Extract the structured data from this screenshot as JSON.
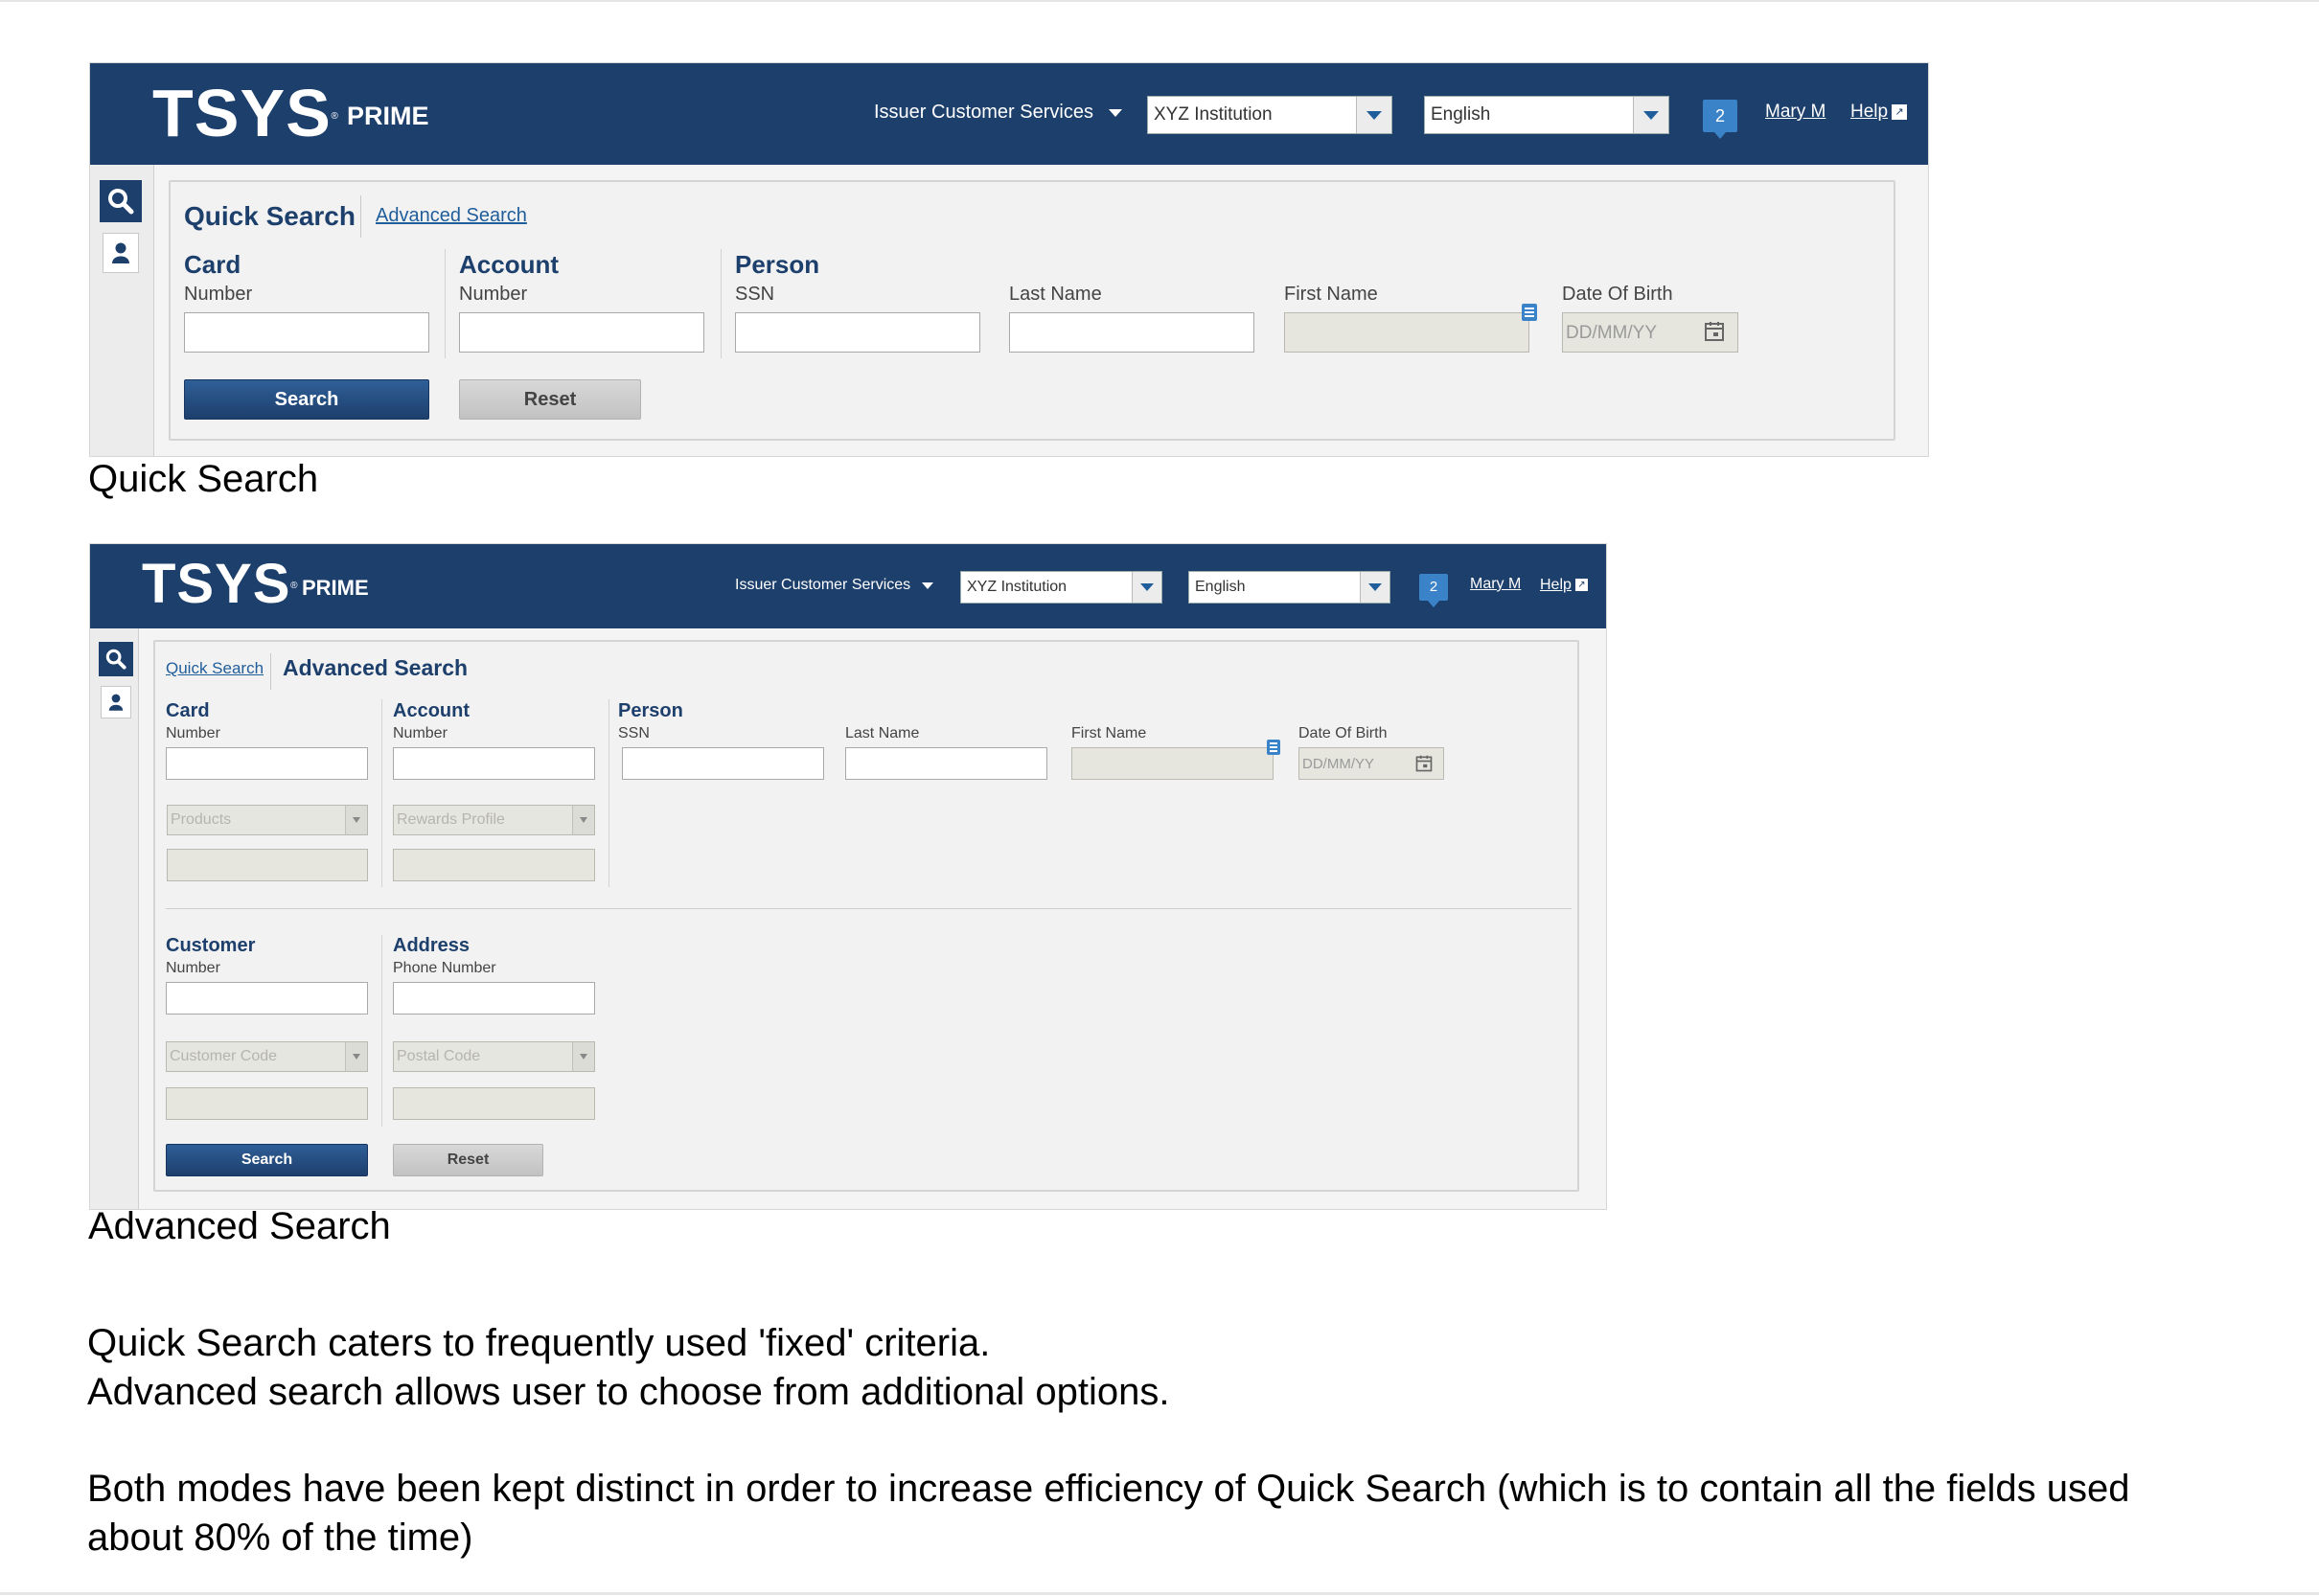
{
  "header": {
    "logo_text": "TSYS",
    "logo_mark": "®",
    "product": "PRIME",
    "service_menu": "Issuer Customer Services",
    "institution": "XYZ Institution",
    "language": "English",
    "notification_count": "2",
    "user": "Mary M",
    "help": "Help",
    "colors": {
      "header_bg": "#1d3f6c",
      "accent": "#3b83c9"
    }
  },
  "quick": {
    "title": "Quick Search",
    "other_link": "Advanced Search",
    "groups": {
      "card": {
        "title": "Card",
        "label": "Number"
      },
      "account": {
        "title": "Account",
        "label": "Number"
      },
      "person": {
        "title": "Person",
        "ssn": "SSN",
        "last_name": "Last Name",
        "first_name": "First Name",
        "dob": "Date Of Birth",
        "dob_placeholder": "DD/MM/YY"
      }
    },
    "search_button": "Search",
    "reset_button": "Reset",
    "caption": "Quick Search"
  },
  "advanced": {
    "title": "Advanced Search",
    "other_link": "Quick Search",
    "groups": {
      "card": {
        "title": "Card",
        "label": "Number",
        "dropdown": "Products"
      },
      "account": {
        "title": "Account",
        "label": "Number",
        "dropdown": "Rewards Profile"
      },
      "person": {
        "title": "Person",
        "ssn": "SSN",
        "last_name": "Last Name",
        "first_name": "First Name",
        "dob": "Date Of Birth",
        "dob_placeholder": "DD/MM/YY"
      },
      "customer": {
        "title": "Customer",
        "label": "Number",
        "dropdown": "Customer Code"
      },
      "address": {
        "title": "Address",
        "label": "Phone Number",
        "dropdown": "Postal Code"
      }
    },
    "search_button": "Search",
    "reset_button": "Reset",
    "caption": "Advanced Search"
  },
  "notes": {
    "line1": "Quick Search caters to frequently used 'fixed' criteria.",
    "line2": "Advanced  search allows user to choose from additional options.",
    "line3": "Both modes have  been kept distinct in order to increase efficiency of Quick Search (which is to contain all the fields used",
    "line4": "about 80% of the time)"
  }
}
